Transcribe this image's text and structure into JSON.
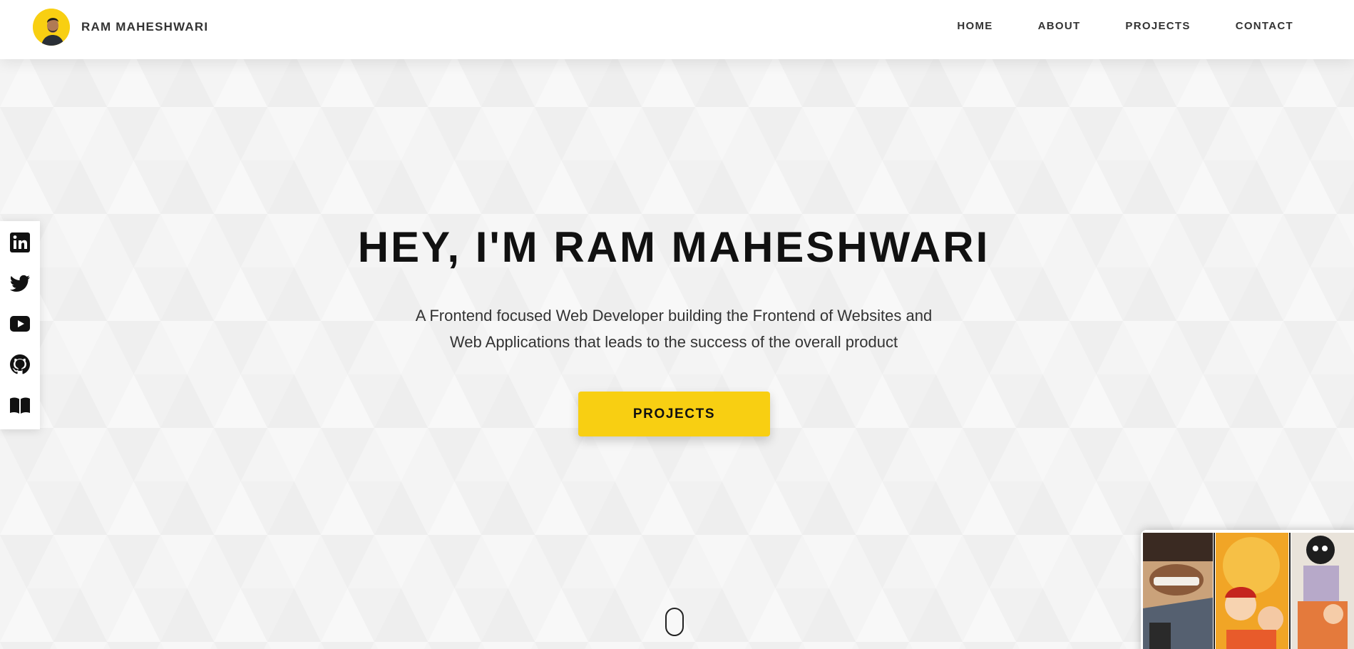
{
  "header": {
    "brand_name": "RAM MAHESHWARI",
    "nav": [
      "HOME",
      "ABOUT",
      "PROJECTS",
      "CONTACT"
    ]
  },
  "social": {
    "icons": [
      "linkedin-icon",
      "twitter-icon",
      "youtube-icon",
      "github-icon",
      "book-icon"
    ]
  },
  "hero": {
    "title": "HEY, I'M RAM MAHESHWARI",
    "subtitle": "A Frontend focused Web Developer building the Frontend of Websites and Web Applications that leads to the success of the overall product",
    "cta_label": "PROJECTS"
  },
  "colors": {
    "accent": "#f8cf12",
    "background": "#f5f5f5",
    "text": "#111111"
  }
}
